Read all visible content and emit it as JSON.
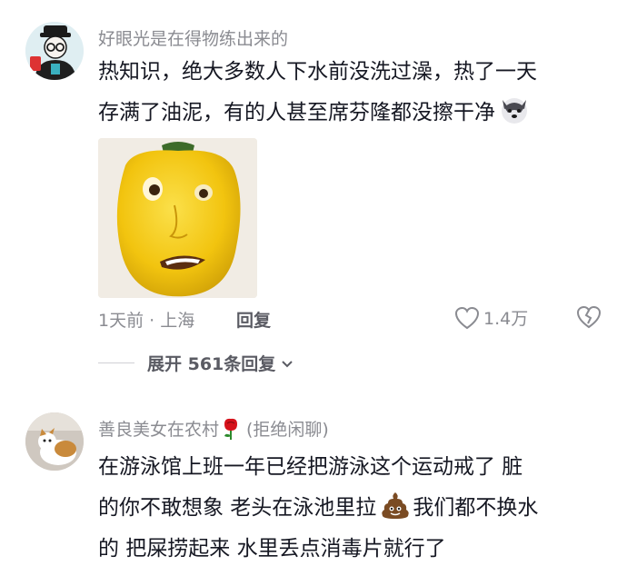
{
  "comment1": {
    "username": "好眼光是在得物练出来的",
    "text_line1": "热知识，绝大多数人下水前没洗过澡，热了一天",
    "text_line2": "存满了油泥，有的人甚至席芬隆都没擦干净",
    "trailing_emoji": "husky-dog-emoji",
    "image_desc": "yellow-pepper-face-meme",
    "time_location": "1天前 · 上海",
    "reply_label": "回复",
    "likes": "1.4万",
    "expand_label": "展开 561条回复"
  },
  "comment2": {
    "username": "善良美女在农村",
    "username_suffix": "(拒绝闲聊)",
    "name_emoji": "rose-emoji",
    "text_line1": "在游泳馆上班一年已经把游泳这个运动戒了 脏",
    "text_line2a": "的你不敢想象  老头在泳池里拉",
    "inline_emoji": "poop-emoji",
    "text_line2b": "我们都不换水",
    "text_line3": "的  把屎捞起来  水里丢点消毒片就行了"
  },
  "colors": {
    "meta": "#8a8b91",
    "text": "#161823",
    "reply": "#5a5b63",
    "pepper": "#f2c40f"
  }
}
